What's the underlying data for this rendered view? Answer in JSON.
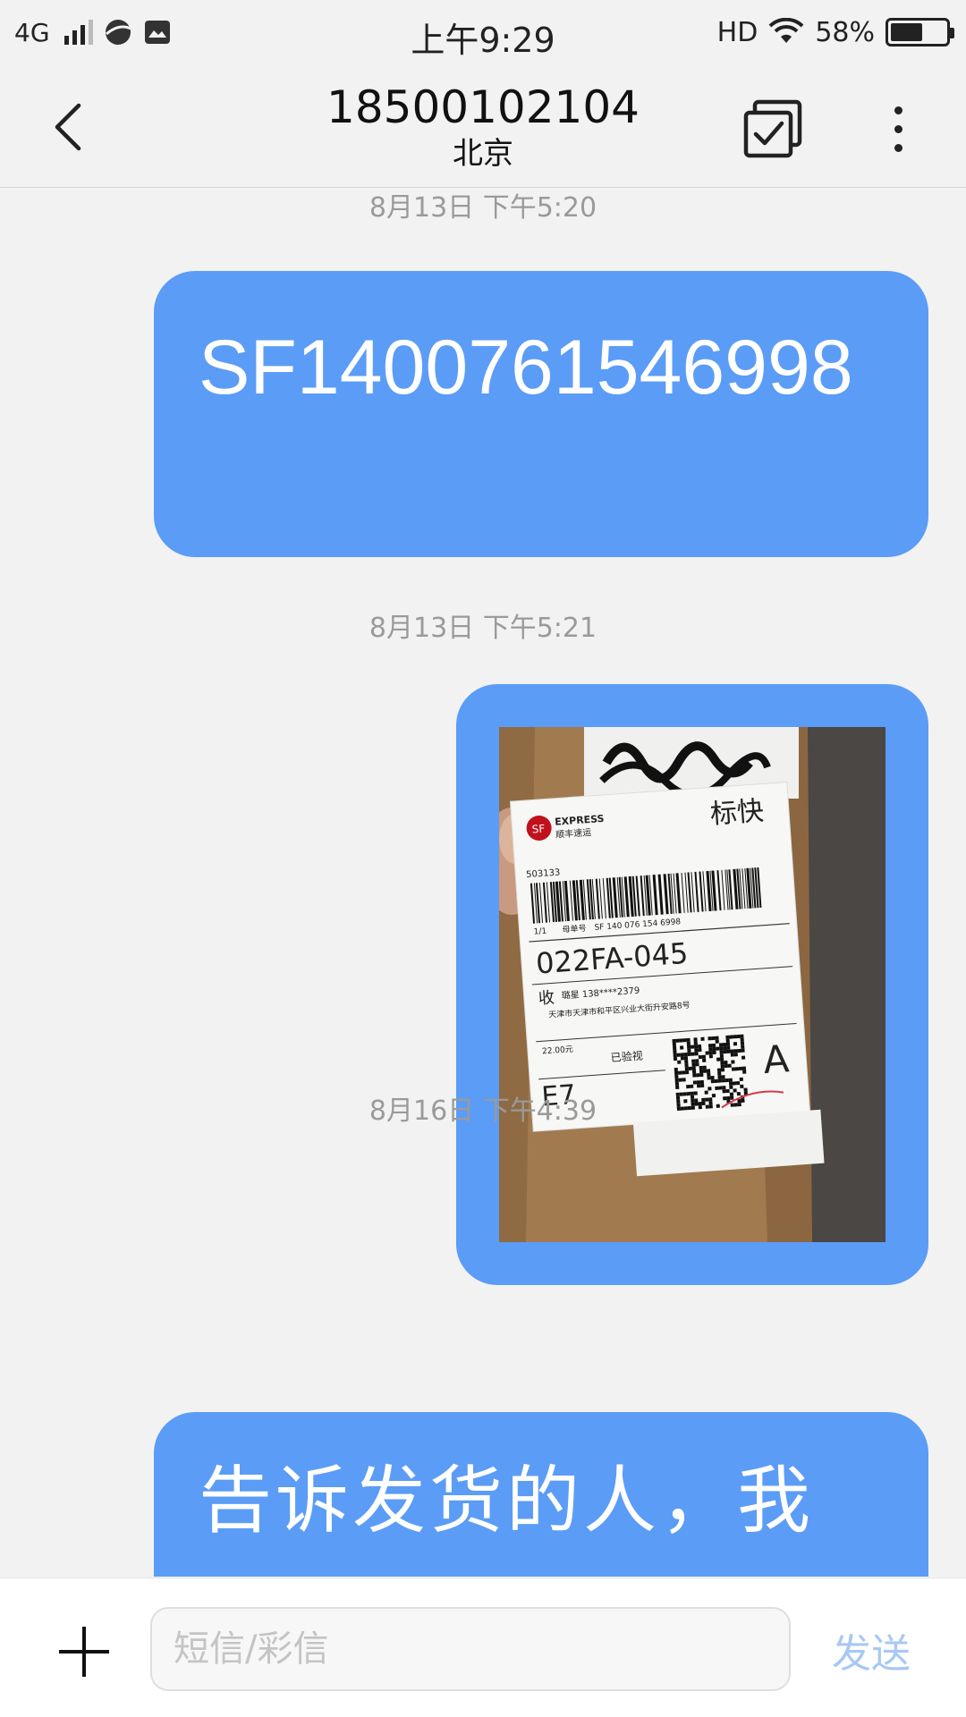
{
  "status_bar": {
    "network": "4G",
    "time": "上午9:29",
    "hd": "HD",
    "battery": "58%",
    "battery_level": 0.58
  },
  "header": {
    "title": "18500102104",
    "subtitle": "北京"
  },
  "messages": [
    {
      "timestamp": "8月13日 下午5:20",
      "type": "text",
      "text": "SF1400761546998"
    },
    {
      "timestamp": "8月13日 下午5:21",
      "type": "image",
      "image": {
        "brand": "EXPRESS",
        "brand_cn": "顺丰速运",
        "service": "标快",
        "waybill": "SF 140 076 154 6998",
        "waybill_label": "母单号",
        "piece": "1/1",
        "route_code": "022FA-045",
        "recipient_tag": "收",
        "recipient": "璐星 138****2379",
        "address": "天津市天津市和平区兴业大街升安路8号",
        "price": "22.00元",
        "checked": "已验视",
        "zone": "E7",
        "grade": "A",
        "code_left": "503133"
      }
    },
    {
      "timestamp": "8月16日 下午4:39",
      "type": "text",
      "text": "告诉发货的人，我"
    }
  ],
  "input_bar": {
    "placeholder": "短信/彩信",
    "send_label": "发送"
  }
}
